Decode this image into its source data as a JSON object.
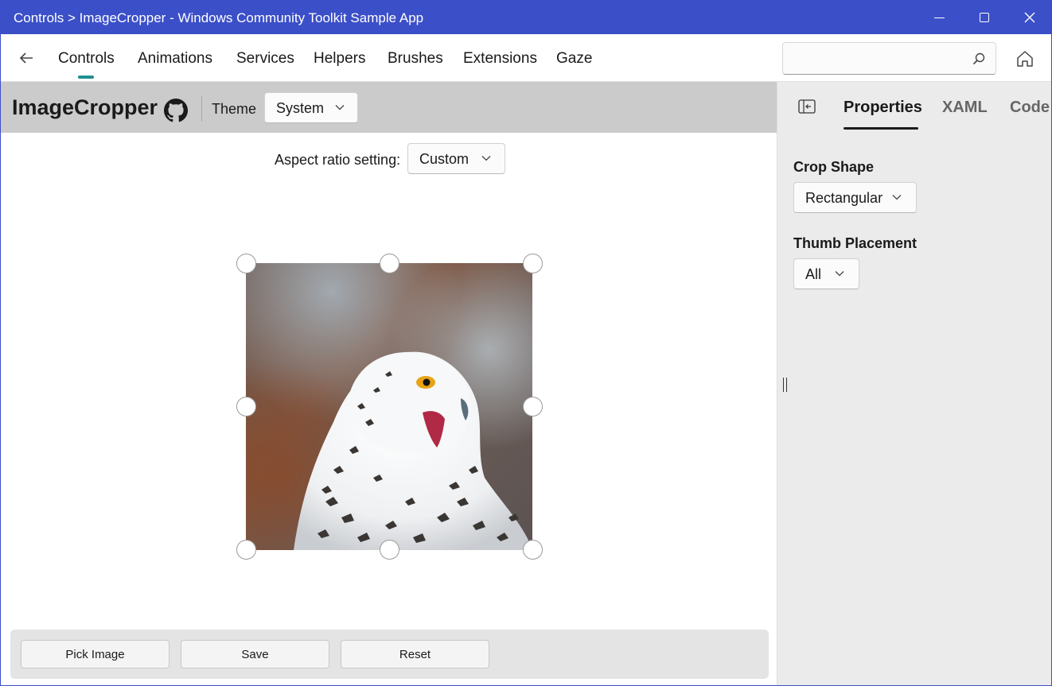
{
  "window": {
    "title": "Controls > ImageCropper - Windows Community Toolkit Sample App"
  },
  "nav": {
    "items": [
      {
        "label": "Controls",
        "active": true
      },
      {
        "label": "Animations"
      },
      {
        "label": "Services"
      },
      {
        "label": "Helpers"
      },
      {
        "label": "Brushes"
      },
      {
        "label": "Extensions"
      },
      {
        "label": "Gaze"
      }
    ],
    "search": {
      "value": "",
      "placeholder": ""
    },
    "accent_color": "#1f8f8f"
  },
  "header": {
    "title": "ImageCropper",
    "theme_label": "Theme",
    "theme_value": "System"
  },
  "main": {
    "aspect_label": "Aspect ratio setting:",
    "aspect_value": "Custom",
    "buttons": {
      "pick": "Pick Image",
      "save": "Save",
      "reset": "Reset"
    }
  },
  "panel": {
    "tabs": [
      {
        "label": "Properties",
        "active": true
      },
      {
        "label": "XAML"
      },
      {
        "label": "Code"
      }
    ],
    "crop_shape_label": "Crop Shape",
    "crop_shape_value": "Rectangular",
    "thumb_placement_label": "Thumb Placement",
    "thumb_placement_value": "All"
  },
  "colors": {
    "titlebar": "#3b4fc9",
    "header_band": "#cbcbcb",
    "panel_bg": "#ebebeb"
  },
  "icons": [
    "back-arrow-icon",
    "search-icon",
    "home-icon",
    "github-icon",
    "chevron-down-icon",
    "side-panel-icon",
    "minimize-icon",
    "maximize-icon",
    "close-icon"
  ]
}
